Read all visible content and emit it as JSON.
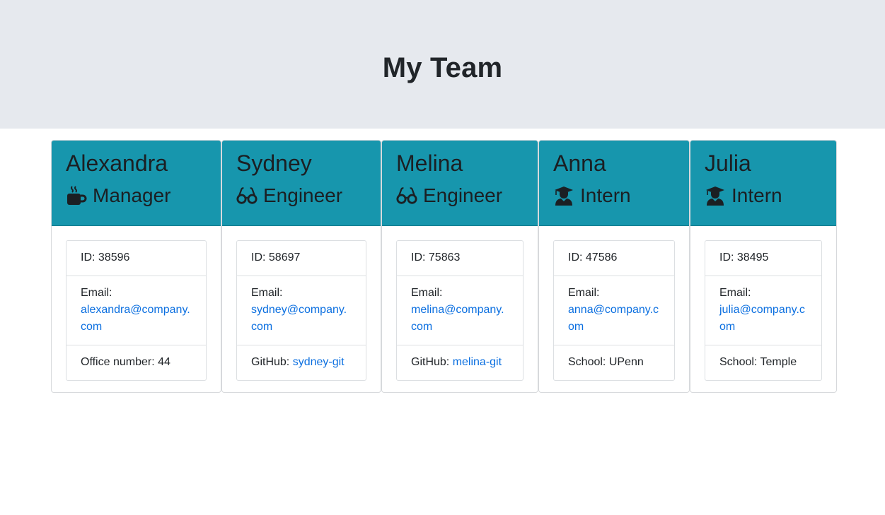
{
  "page": {
    "title": "My Team"
  },
  "labels": {
    "email": "Email:",
    "github": "GitHub:"
  },
  "colors": {
    "header_bg": "#e6e9ee",
    "card_header": "#1796ad",
    "link": "#0b6fe0"
  },
  "team": [
    {
      "name": "Alexandra",
      "role": "Manager",
      "icon": "coffee-mug-icon",
      "id": "ID: 38596",
      "email": "alexandra@company.com",
      "extra_label": "Office number: 44"
    },
    {
      "name": "Sydney",
      "role": "Engineer",
      "icon": "glasses-icon",
      "id": "ID: 58697",
      "email": "sydney@company.com",
      "extra_label": "GitHub: ",
      "extra_link": "sydney-git"
    },
    {
      "name": "Melina",
      "role": "Engineer",
      "icon": "glasses-icon",
      "id": "ID: 75863",
      "email": "melina@company.com",
      "extra_label": "GitHub: ",
      "extra_link": "melina-git"
    },
    {
      "name": "Anna",
      "role": "Intern",
      "icon": "graduate-icon",
      "id": "ID: 47586",
      "email": "anna@company.com",
      "extra_label": "School: UPenn"
    },
    {
      "name": "Julia",
      "role": "Intern",
      "icon": "graduate-icon",
      "id": "ID: 38495",
      "email": "julia@company.com",
      "extra_label": "School: Temple"
    }
  ]
}
